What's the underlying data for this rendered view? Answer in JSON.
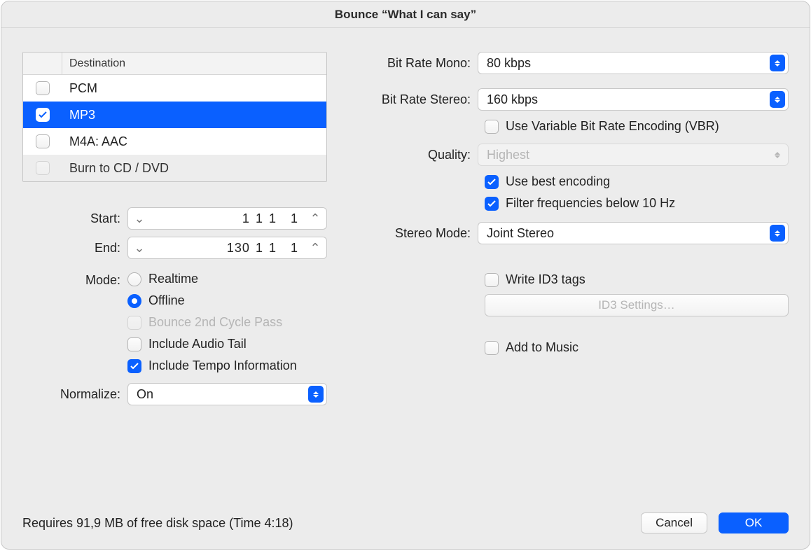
{
  "title": "Bounce “What I can say”",
  "dest": {
    "header": "Destination",
    "items": [
      {
        "label": "PCM",
        "checked": false,
        "selected": false
      },
      {
        "label": "MP3",
        "checked": true,
        "selected": true
      },
      {
        "label": "M4A: AAC",
        "checked": false,
        "selected": false
      },
      {
        "label": "Burn to CD / DVD",
        "checked": false,
        "selected": false,
        "disabled": true
      }
    ]
  },
  "range": {
    "start_label": "Start:",
    "end_label": "End:",
    "start": {
      "a": "1",
      "b": "1",
      "c": "1",
      "d": "1"
    },
    "end": {
      "a": "130",
      "b": "1",
      "c": "1",
      "d": "1"
    }
  },
  "mode": {
    "label": "Mode:",
    "realtime": "Realtime",
    "offline": "Offline",
    "selected": "offline",
    "second_pass": "Bounce 2nd Cycle Pass",
    "include_tail": "Include Audio Tail",
    "include_tempo": "Include Tempo Information"
  },
  "normalize": {
    "label": "Normalize:",
    "value": "On"
  },
  "right": {
    "mono_label": "Bit Rate Mono:",
    "mono_value": "80 kbps",
    "stereo_label": "Bit Rate Stereo:",
    "stereo_value": "160 kbps",
    "vbr": "Use Variable Bit Rate Encoding (VBR)",
    "quality_label": "Quality:",
    "quality_value": "Highest",
    "best_enc": "Use best encoding",
    "filter10": "Filter frequencies below 10 Hz",
    "stereo_mode_label": "Stereo Mode:",
    "stereo_mode_value": "Joint Stereo",
    "write_id3": "Write ID3 tags",
    "id3_btn": "ID3 Settings…",
    "add_music": "Add to Music"
  },
  "footer": {
    "status": "Requires 91,9 MB of free disk space  (Time 4:18)",
    "cancel": "Cancel",
    "ok": "OK"
  }
}
